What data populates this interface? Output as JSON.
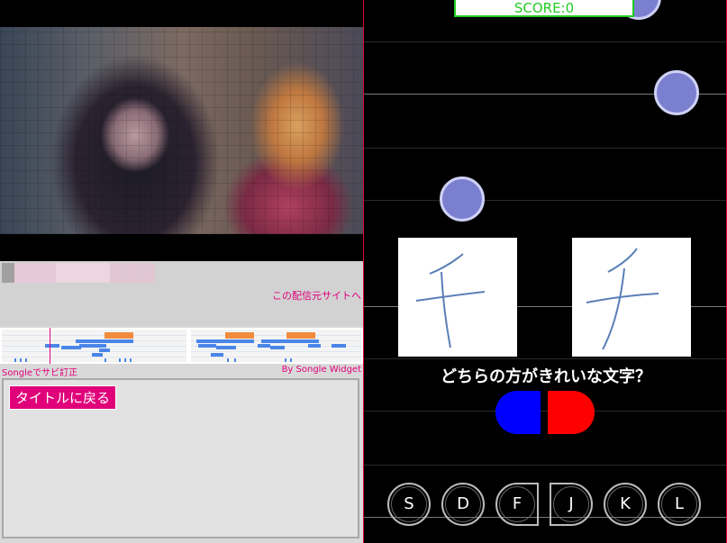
{
  "left": {
    "source_link": "この配信元サイトへ",
    "songle_fix": "Songleでサビ訂正",
    "songle_by": "By Songle Widget",
    "back_button": "タイトルに戻る"
  },
  "game": {
    "score": "SCORE:0",
    "question": "どちらの方がきれいな文字？",
    "keys": [
      "S",
      "D",
      "F",
      "J",
      "K",
      "L"
    ],
    "choice_colors": {
      "left": "#0000ff",
      "right": "#ff0000"
    },
    "note_color": "#7b7fcf"
  }
}
